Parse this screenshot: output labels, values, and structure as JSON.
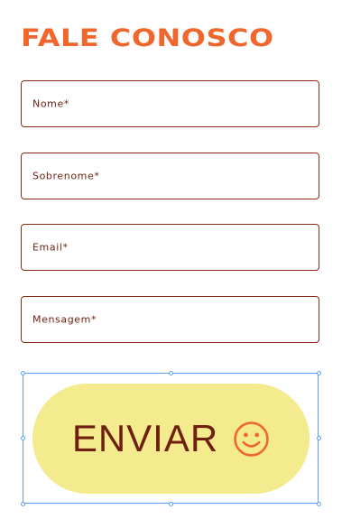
{
  "form": {
    "title": "FALE CONOSCO",
    "fields": [
      {
        "label": "Nome*"
      },
      {
        "label": "Sobrenome*"
      },
      {
        "label": "Email*"
      },
      {
        "label": "Mensagem*"
      }
    ],
    "submit": {
      "label": "ENVIAR",
      "icon": "smile-icon"
    }
  },
  "colors": {
    "title": "#f0662c",
    "field_border": "#8a2a19",
    "field_text": "#6e2214",
    "button_background": "#f4ea8e",
    "button_text": "#6e1f10",
    "icon": "#f0662c",
    "selection_outline": "#5aa0f2"
  }
}
